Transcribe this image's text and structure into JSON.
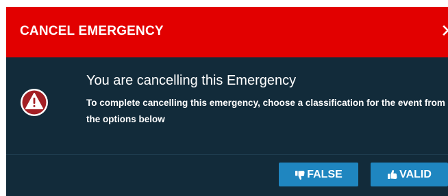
{
  "dialog": {
    "title": "CANCEL EMERGENCY",
    "close_icon": "close-icon",
    "message_title": "You are cancelling this Emergency",
    "message_detail": "To complete cancelling this emergency, choose a classification for the event from the options below",
    "alert_icon": "warning-triangle-icon"
  },
  "actions": {
    "false_label": "FALSE",
    "false_icon": "thumbs-down-icon",
    "valid_label": "VALID",
    "valid_icon": "thumbs-up-icon"
  },
  "colors": {
    "header": "#e20000",
    "body": "#122b3a",
    "button": "#1f86c0",
    "alert_red": "#a31f24"
  }
}
